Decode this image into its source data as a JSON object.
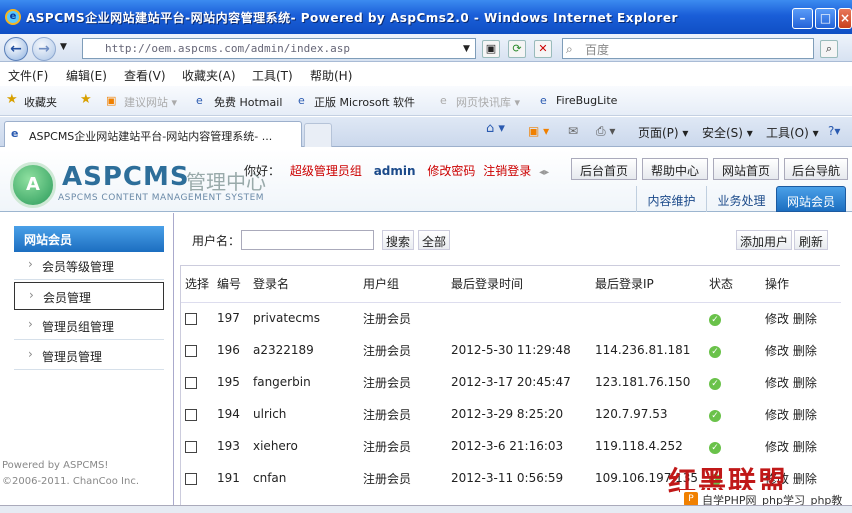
{
  "window": {
    "title": "ASPCMS企业网站建站平台-网站内容管理系统- Powered by AspCms2.0 - Windows Internet Explorer"
  },
  "browser": {
    "address": "http://oem.aspcms.com/admin/index.asp",
    "search_placeholder": "百度",
    "menu": [
      "文件(F)",
      "编辑(E)",
      "查看(V)",
      "收藏夹(A)",
      "工具(T)",
      "帮助(H)"
    ],
    "favorites_label": "收藏夹",
    "favorites": [
      "建议网站 ▾",
      "免费 Hotmail",
      "正版 Microsoft 软件",
      "网页快讯库 ▾",
      "FireBugLite"
    ],
    "tab_title": "ASPCMS企业网站建站平台-网站内容管理系统- ...",
    "commands": [
      "页面(P) ▾",
      "安全(S) ▾",
      "工具(O) ▾"
    ]
  },
  "header": {
    "logo": "ASPCMS",
    "logo_sub": "管理中心",
    "logo_en": "ASPCMS CONTENT MANAGEMENT SYSTEM",
    "greeting": "你好：",
    "role": "超级管理员组",
    "user": "admin",
    "change_password": "修改密码",
    "logout": "注销登录",
    "buttons": [
      "后台首页",
      "帮助中心",
      "网站首页",
      "后台导航"
    ],
    "tabs": [
      "内容维护",
      "业务处理",
      "网站会员"
    ]
  },
  "sidebar": {
    "title": "网站会员",
    "items": [
      "会员等级管理",
      "会员管理",
      "管理员组管理",
      "管理员管理"
    ],
    "powered": "Powered by ASPCMS!",
    "copyright": "©2006-2011. ChanCoo Inc."
  },
  "toolbar": {
    "username_label": "用户名：",
    "search": "搜索",
    "all": "全部",
    "add_user": "添加用户",
    "refresh": "刷新"
  },
  "table": {
    "headers": [
      "选择",
      "编号",
      "登录名",
      "用户组",
      "最后登录时间",
      "最后登录IP",
      "状态",
      "操作"
    ],
    "rows": [
      {
        "id": "197",
        "login": "privatecms",
        "group": "注册会员",
        "time": "",
        "ip": "",
        "actions": "修改 删除"
      },
      {
        "id": "196",
        "login": "a2322189",
        "group": "注册会员",
        "time": "2012-5-30 11:29:48",
        "ip": "114.236.81.181",
        "actions": "修改 删除"
      },
      {
        "id": "195",
        "login": "fangerbin",
        "group": "注册会员",
        "time": "2012-3-17 20:45:47",
        "ip": "123.181.76.150",
        "actions": "修改 删除"
      },
      {
        "id": "194",
        "login": "ulrich",
        "group": "注册会员",
        "time": "2012-3-29 8:25:20",
        "ip": "120.7.97.53",
        "actions": "修改 删除"
      },
      {
        "id": "193",
        "login": "xiehero",
        "group": "注册会员",
        "time": "2012-3-6 21:16:03",
        "ip": "119.118.4.252",
        "actions": "修改 删除"
      },
      {
        "id": "191",
        "login": "cnfan",
        "group": "注册会员",
        "time": "2012-3-11 0:56:59",
        "ip": "109.106.197.135",
        "actions": "修改 删除"
      }
    ]
  },
  "watermark": {
    "text": "红黑联盟",
    "site": "自学PHP网_php学习_php教"
  }
}
